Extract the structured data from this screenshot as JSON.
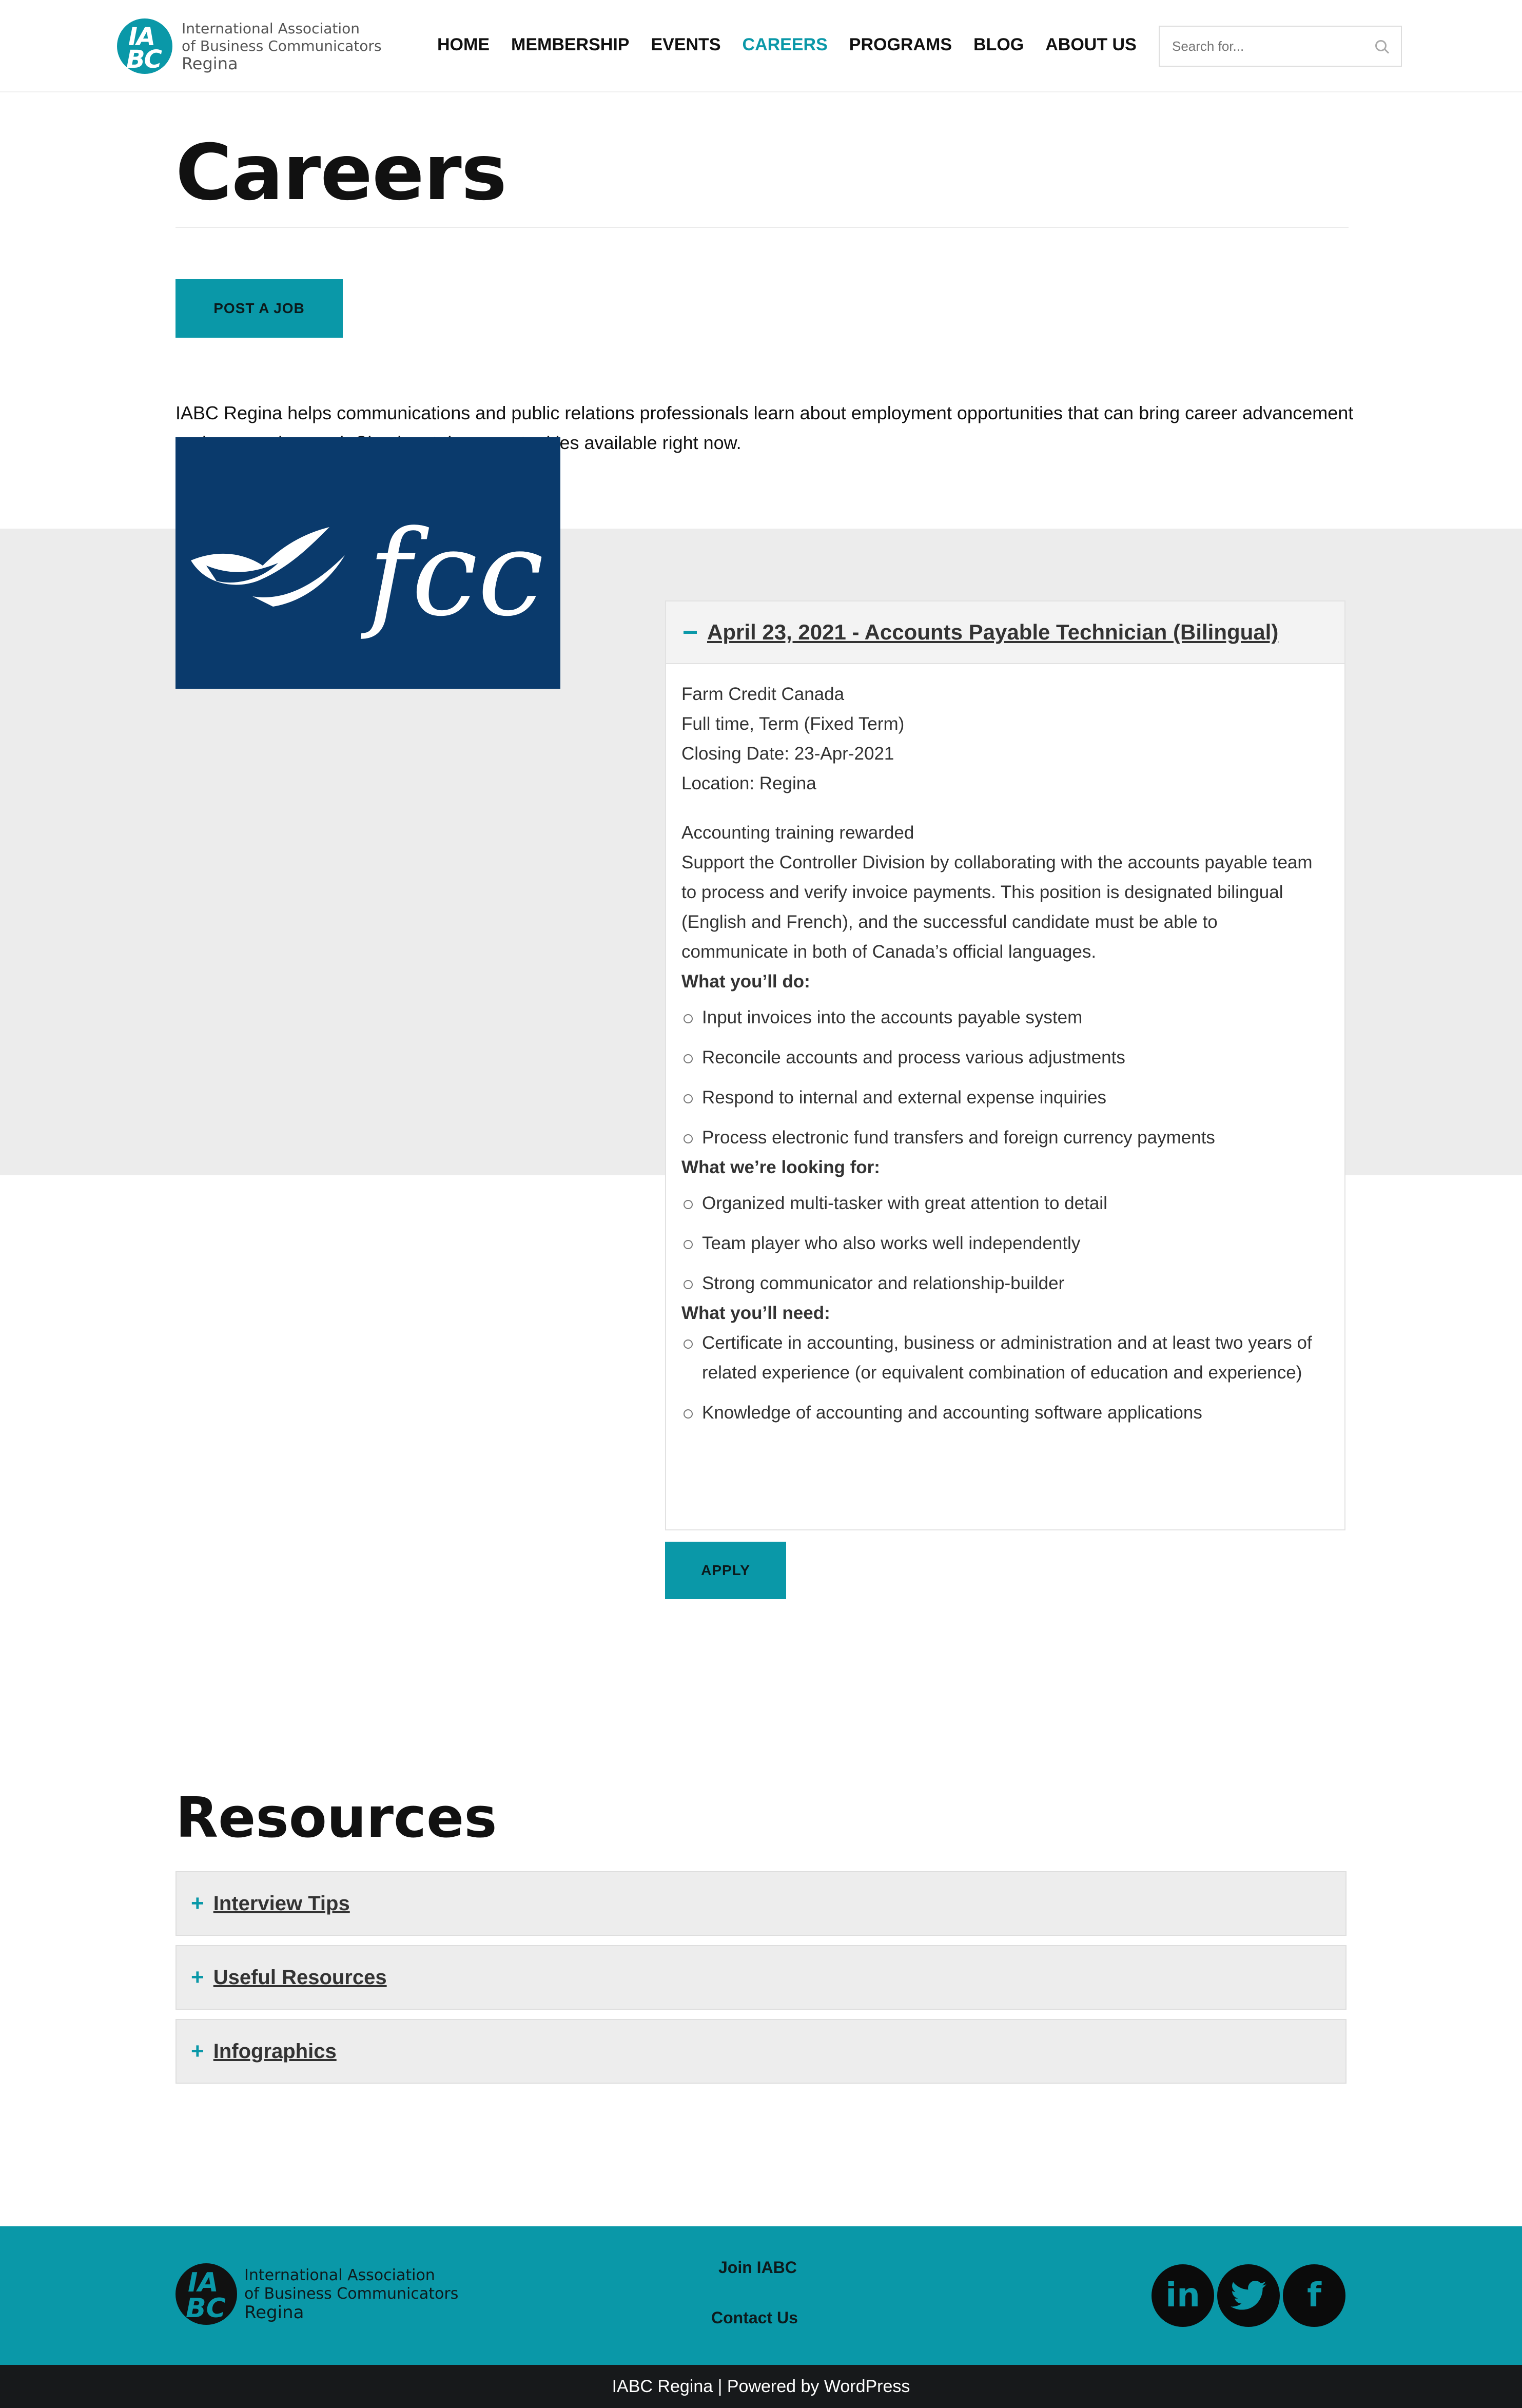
{
  "header": {
    "logo": {
      "line1": "International Association",
      "line2": "of Business Communicators",
      "city": "Regina",
      "mark_top": "IA",
      "mark_bottom": "BC"
    },
    "nav": [
      "HOME",
      "MEMBERSHIP",
      "EVENTS",
      "CAREERS",
      "PROGRAMS",
      "BLOG",
      "ABOUT US"
    ],
    "active_nav": "CAREERS",
    "search_placeholder": "Search for..."
  },
  "page": {
    "title": "Careers",
    "post_job_label": "POST A JOB",
    "intro": "IABC Regina helps communications and public relations professionals learn about employment opportunities that can bring career advancement and personal reward. Check out the opportunities available right now."
  },
  "job": {
    "logo_text": "fcc",
    "title": "April 23, 2021 - Accounts Payable Technician (Bilingual)",
    "company": "Farm Credit Canada",
    "type": "Full time, Term (Fixed Term)",
    "closing": "Closing Date: 23-Apr-2021",
    "location": "Location: Regina",
    "tagline": "Accounting training rewarded",
    "description": "Support the Controller Division by collaborating with the accounts payable team to process and verify invoice payments. This position is designated bilingual (English and French), and the successful candidate must be able to communicate in both of Canada’s official languages.",
    "do_heading": "What you’ll do:",
    "do_items": [
      "Input invoices into the accounts payable system",
      "Reconcile accounts and process various adjustments",
      "Respond to internal and external expense inquiries",
      "Process electronic fund transfers and foreign currency payments"
    ],
    "look_heading": "What we’re looking for:",
    "look_items": [
      "Organized multi-tasker with great attention to detail",
      "Team player who also works well independently",
      "Strong communicator and relationship-builder"
    ],
    "need_heading": "What you’ll need:",
    "need_items": [
      "Certificate in accounting, business or administration and at least two years of related experience (or equivalent combination of education and experience)",
      "Knowledge of accounting and accounting software applications"
    ],
    "apply_label": "APPLY"
  },
  "resources": {
    "title": "Resources",
    "items": [
      "Interview Tips",
      "Useful Resources",
      "Infographics"
    ]
  },
  "footer": {
    "logo": {
      "line1": "International Association",
      "line2": "of Business Communicators",
      "city": "Regina",
      "mark_top": "IA",
      "mark_bottom": "BC"
    },
    "links": [
      "Join IABC",
      "Contact Us"
    ],
    "social": [
      "linkedin-icon",
      "twitter-icon",
      "facebook-icon"
    ],
    "bottom_text": "IABC Regina | Powered by WordPress"
  },
  "colors": {
    "accent": "#0a98a8",
    "fcc_blue": "#0a3a6c",
    "section_gray": "#ececec",
    "bottom_bar": "#17191b"
  }
}
